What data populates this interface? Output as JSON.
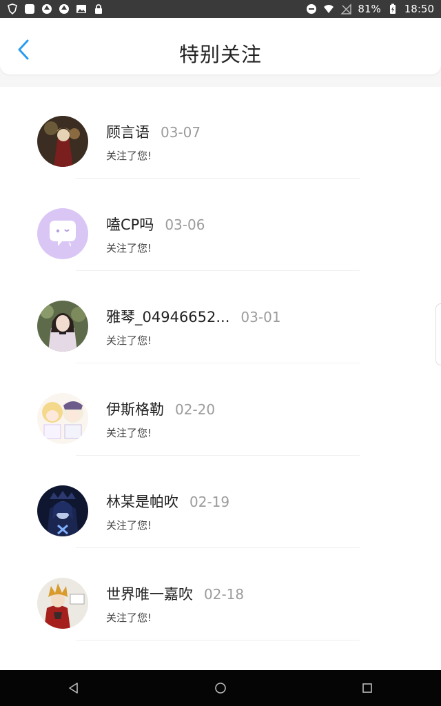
{
  "status_bar": {
    "battery_percent": "81%",
    "time": "18:50"
  },
  "header": {
    "title": "特别关注"
  },
  "items": [
    {
      "name": "顾言语",
      "date": "03-07",
      "subtitle": "关注了您!",
      "avatar": "anime-character-avatar"
    },
    {
      "name": "嗑CP吗",
      "date": "03-06",
      "subtitle": "关注了您!",
      "avatar": "chat-bubble-avatar"
    },
    {
      "name": "雅琴_04946652...",
      "date": "03-01",
      "subtitle": "关注了您!",
      "avatar": "girl-photo-avatar"
    },
    {
      "name": "伊斯格勒",
      "date": "02-20",
      "subtitle": "关注了您!",
      "avatar": "chibi-characters-avatar"
    },
    {
      "name": "林某是帕吹",
      "date": "02-19",
      "subtitle": "关注了您!",
      "avatar": "dark-anime-avatar"
    },
    {
      "name": "世界唯一嘉吹",
      "date": "02-18",
      "subtitle": "关注了您!",
      "avatar": "red-coat-character-avatar"
    }
  ],
  "colors": {
    "accent": "#2a9bf0",
    "date_gray": "#9b9b9b",
    "purple_avatar": "#d9c6f5"
  }
}
